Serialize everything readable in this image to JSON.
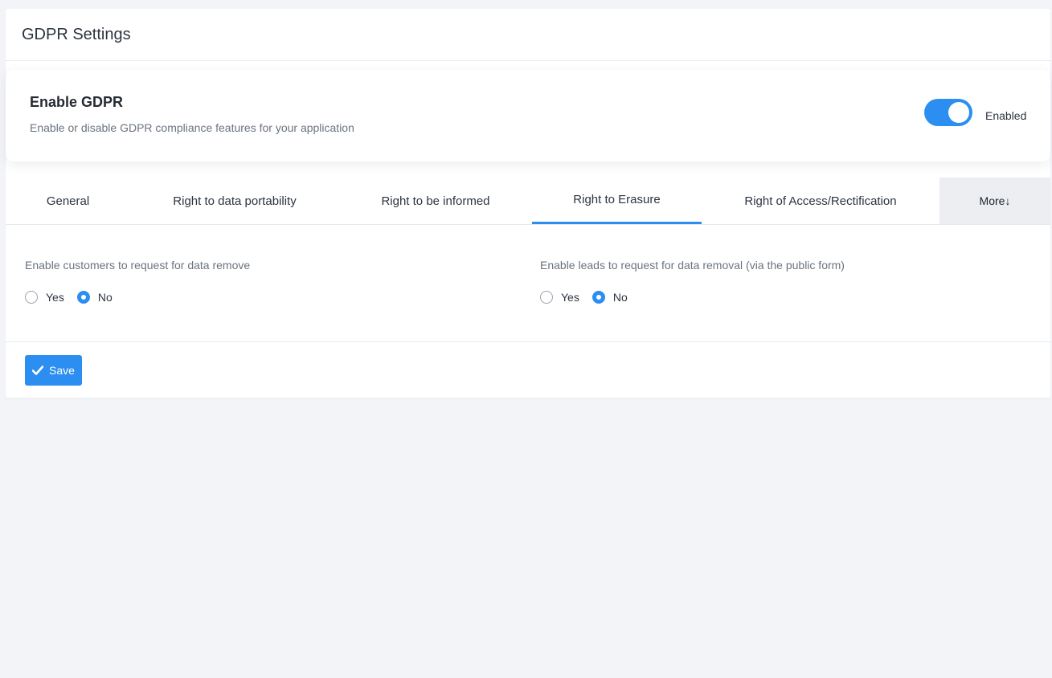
{
  "header": {
    "title": "GDPR Settings"
  },
  "gdpr": {
    "title": "Enable GDPR",
    "description": "Enable or disable GDPR compliance features for your application",
    "toggle_state": "Enabled"
  },
  "tabs": [
    {
      "label": "General"
    },
    {
      "label": "Right to data portability"
    },
    {
      "label": "Right to be informed"
    },
    {
      "label": "Right to Erasure",
      "active": true
    },
    {
      "label": "Right of Access/Rectification"
    }
  ],
  "more_tab": {
    "label": "More↓"
  },
  "erasure": {
    "customers": {
      "label": "Enable customers to request for data remove",
      "yes": "Yes",
      "no": "No",
      "selected": "No"
    },
    "leads": {
      "label": "Enable leads to request for data removal (via the public form)",
      "yes": "Yes",
      "no": "No",
      "selected": "No"
    }
  },
  "footer": {
    "save_label": "Save"
  },
  "colors": {
    "accent": "#2c8ef0",
    "background": "#f2f4f7"
  }
}
